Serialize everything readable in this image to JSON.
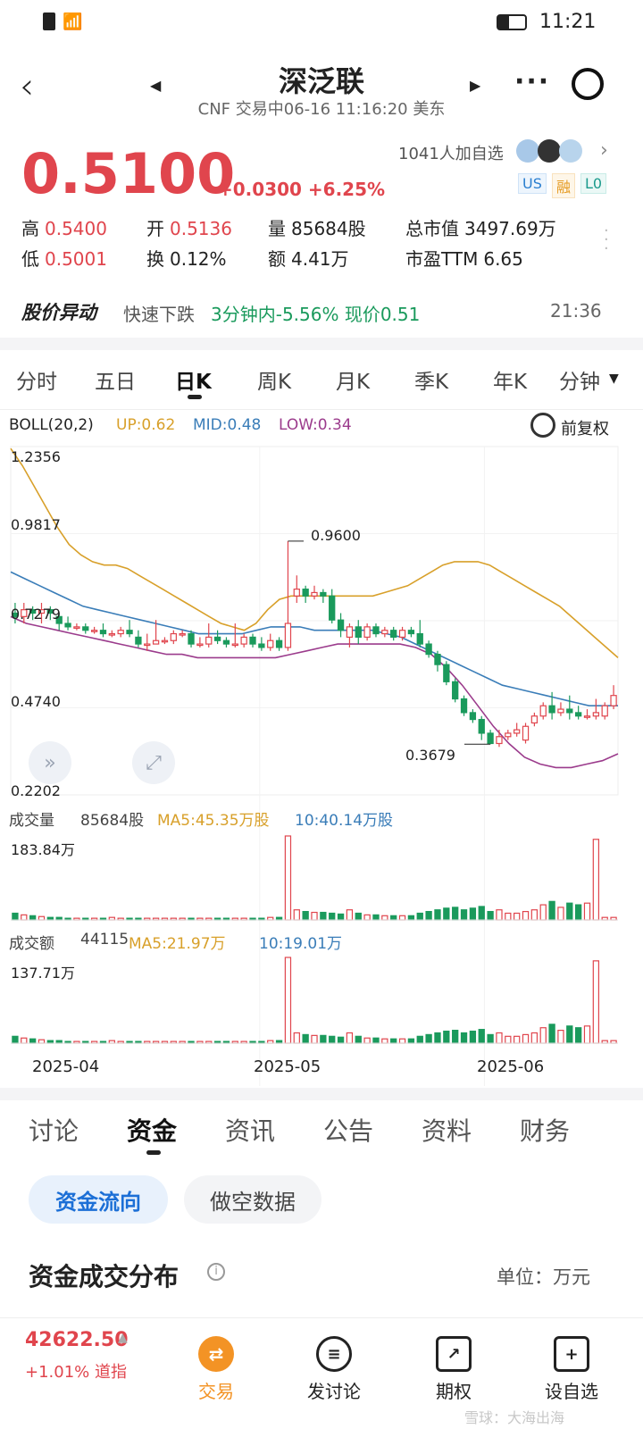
{
  "status": {
    "time": "11:21"
  },
  "header": {
    "title": "深泛联",
    "subtitle": "CNF 交易中06-16 11:16:20 美东"
  },
  "quote": {
    "price": "0.5100",
    "change": "+0.0300 +6.25%",
    "watchers": "1041人加自选",
    "badges": [
      "US",
      "融",
      "L0"
    ],
    "stats": [
      {
        "label": "高",
        "value": "0.5400",
        "color": "red"
      },
      {
        "label": "开",
        "value": "0.5136",
        "color": "red"
      },
      {
        "label": "量",
        "value": "85684股",
        "color": "plain"
      },
      {
        "label": "总市值",
        "value": "3497.69万",
        "color": "plain"
      },
      {
        "label": "低",
        "value": "0.5001",
        "color": "red"
      },
      {
        "label": "换",
        "value": "0.12%",
        "color": "plain"
      },
      {
        "label": "额",
        "value": "4.41万",
        "color": "plain"
      },
      {
        "label": "市盈TTM",
        "value": "6.65",
        "color": "plain"
      }
    ]
  },
  "alert": {
    "label": "股价异动",
    "type": "快速下跌",
    "detail": "3分钟内-5.56% 现价0.51",
    "time": "21:36"
  },
  "period_tabs": [
    "分时",
    "五日",
    "日K",
    "周K",
    "月K",
    "季K",
    "年K",
    "分钟"
  ],
  "active_period": "日K",
  "boll": {
    "name": "BOLL(20,2)",
    "up": "UP:0.62",
    "mid": "MID:0.48",
    "low": "LOW:0.34",
    "adjust": "前复权"
  },
  "price_axis": [
    "1.2356",
    "0.9817",
    "0.7279",
    "0.4740",
    "0.2202"
  ],
  "annotations": {
    "high": "0.9600",
    "low": "0.3679"
  },
  "volume": {
    "label": "成交量",
    "value": "85684股",
    "ma5": "MA5:45.35万股",
    "ma10": "10:40.14万股",
    "max": "183.84万"
  },
  "amount": {
    "label": "成交额",
    "value": "44115",
    "ma5": "MA5:21.97万",
    "ma10": "10:19.01万",
    "max": "137.71万"
  },
  "x_dates": [
    "2025-04",
    "2025-05",
    "2025-06"
  ],
  "chart_data": {
    "type": "candlestick",
    "price_range": [
      0.2202,
      1.2356
    ],
    "candles": [
      {
        "o": 0.75,
        "c": 0.74,
        "h": 0.78,
        "l": 0.72,
        "v": 8
      },
      {
        "o": 0.74,
        "c": 0.76,
        "h": 0.78,
        "l": 0.72,
        "v": 6
      },
      {
        "o": 0.76,
        "c": 0.75,
        "h": 0.77,
        "l": 0.73,
        "v": 5
      },
      {
        "o": 0.75,
        "c": 0.76,
        "h": 0.78,
        "l": 0.72,
        "v": 4
      },
      {
        "o": 0.76,
        "c": 0.75,
        "h": 0.77,
        "l": 0.73,
        "v": 3
      },
      {
        "o": 0.74,
        "c": 0.72,
        "h": 0.75,
        "l": 0.7,
        "v": 3
      },
      {
        "o": 0.72,
        "c": 0.71,
        "h": 0.74,
        "l": 0.7,
        "v": 2
      },
      {
        "o": 0.71,
        "c": 0.71,
        "h": 0.72,
        "l": 0.7,
        "v": 2
      },
      {
        "o": 0.71,
        "c": 0.7,
        "h": 0.72,
        "l": 0.69,
        "v": 2
      },
      {
        "o": 0.7,
        "c": 0.7,
        "h": 0.71,
        "l": 0.69,
        "v": 2
      },
      {
        "o": 0.7,
        "c": 0.69,
        "h": 0.72,
        "l": 0.68,
        "v": 2
      },
      {
        "o": 0.69,
        "c": 0.69,
        "h": 0.7,
        "l": 0.68,
        "v": 3
      },
      {
        "o": 0.69,
        "c": 0.7,
        "h": 0.71,
        "l": 0.68,
        "v": 2
      },
      {
        "o": 0.7,
        "c": 0.69,
        "h": 0.73,
        "l": 0.68,
        "v": 2
      },
      {
        "o": 0.68,
        "c": 0.66,
        "h": 0.7,
        "l": 0.65,
        "v": 2
      },
      {
        "o": 0.66,
        "c": 0.66,
        "h": 0.69,
        "l": 0.64,
        "v": 2
      },
      {
        "o": 0.66,
        "c": 0.67,
        "h": 0.73,
        "l": 0.66,
        "v": 2
      },
      {
        "o": 0.67,
        "c": 0.67,
        "h": 0.68,
        "l": 0.66,
        "v": 2
      },
      {
        "o": 0.67,
        "c": 0.69,
        "h": 0.7,
        "l": 0.66,
        "v": 2
      },
      {
        "o": 0.69,
        "c": 0.69,
        "h": 0.7,
        "l": 0.68,
        "v": 2
      },
      {
        "o": 0.69,
        "c": 0.66,
        "h": 0.7,
        "l": 0.65,
        "v": 2
      },
      {
        "o": 0.66,
        "c": 0.66,
        "h": 0.68,
        "l": 0.65,
        "v": 2
      },
      {
        "o": 0.66,
        "c": 0.68,
        "h": 0.72,
        "l": 0.65,
        "v": 2
      },
      {
        "o": 0.68,
        "c": 0.67,
        "h": 0.7,
        "l": 0.66,
        "v": 2
      },
      {
        "o": 0.67,
        "c": 0.66,
        "h": 0.68,
        "l": 0.65,
        "v": 2
      },
      {
        "o": 0.66,
        "c": 0.66,
        "h": 0.72,
        "l": 0.65,
        "v": 2
      },
      {
        "o": 0.66,
        "c": 0.68,
        "h": 0.69,
        "l": 0.65,
        "v": 2
      },
      {
        "o": 0.68,
        "c": 0.66,
        "h": 0.69,
        "l": 0.65,
        "v": 2
      },
      {
        "o": 0.66,
        "c": 0.65,
        "h": 0.68,
        "l": 0.64,
        "v": 2
      },
      {
        "o": 0.65,
        "c": 0.67,
        "h": 0.69,
        "l": 0.64,
        "v": 3
      },
      {
        "o": 0.67,
        "c": 0.65,
        "h": 0.68,
        "l": 0.64,
        "v": 3
      },
      {
        "o": 0.65,
        "c": 0.72,
        "h": 0.96,
        "l": 0.64,
        "v": 100
      },
      {
        "o": 0.8,
        "c": 0.82,
        "h": 0.86,
        "l": 0.78,
        "v": 12
      },
      {
        "o": 0.82,
        "c": 0.8,
        "h": 0.83,
        "l": 0.78,
        "v": 10
      },
      {
        "o": 0.8,
        "c": 0.81,
        "h": 0.83,
        "l": 0.79,
        "v": 9
      },
      {
        "o": 0.81,
        "c": 0.8,
        "h": 0.82,
        "l": 0.78,
        "v": 9
      },
      {
        "o": 0.8,
        "c": 0.73,
        "h": 0.82,
        "l": 0.72,
        "v": 8
      },
      {
        "o": 0.73,
        "c": 0.7,
        "h": 0.75,
        "l": 0.68,
        "v": 7
      },
      {
        "o": 0.68,
        "c": 0.71,
        "h": 0.72,
        "l": 0.65,
        "v": 12
      },
      {
        "o": 0.71,
        "c": 0.68,
        "h": 0.73,
        "l": 0.66,
        "v": 8
      },
      {
        "o": 0.68,
        "c": 0.71,
        "h": 0.72,
        "l": 0.67,
        "v": 6
      },
      {
        "o": 0.71,
        "c": 0.69,
        "h": 0.72,
        "l": 0.68,
        "v": 6
      },
      {
        "o": 0.69,
        "c": 0.7,
        "h": 0.71,
        "l": 0.68,
        "v": 5
      },
      {
        "o": 0.7,
        "c": 0.68,
        "h": 0.71,
        "l": 0.67,
        "v": 5
      },
      {
        "o": 0.68,
        "c": 0.7,
        "h": 0.71,
        "l": 0.67,
        "v": 5
      },
      {
        "o": 0.7,
        "c": 0.69,
        "h": 0.71,
        "l": 0.68,
        "v": 5
      },
      {
        "o": 0.69,
        "c": 0.66,
        "h": 0.73,
        "l": 0.65,
        "v": 8
      },
      {
        "o": 0.66,
        "c": 0.63,
        "h": 0.67,
        "l": 0.62,
        "v": 10
      },
      {
        "o": 0.63,
        "c": 0.6,
        "h": 0.64,
        "l": 0.58,
        "v": 12
      },
      {
        "o": 0.6,
        "c": 0.55,
        "h": 0.61,
        "l": 0.54,
        "v": 14
      },
      {
        "o": 0.55,
        "c": 0.5,
        "h": 0.56,
        "l": 0.49,
        "v": 15
      },
      {
        "o": 0.5,
        "c": 0.46,
        "h": 0.51,
        "l": 0.45,
        "v": 12
      },
      {
        "o": 0.46,
        "c": 0.44,
        "h": 0.47,
        "l": 0.43,
        "v": 14
      },
      {
        "o": 0.44,
        "c": 0.4,
        "h": 0.45,
        "l": 0.38,
        "v": 16
      },
      {
        "o": 0.4,
        "c": 0.37,
        "h": 0.41,
        "l": 0.3679,
        "v": 10
      },
      {
        "o": 0.37,
        "c": 0.39,
        "h": 0.41,
        "l": 0.36,
        "v": 12
      },
      {
        "o": 0.39,
        "c": 0.4,
        "h": 0.41,
        "l": 0.38,
        "v": 8
      },
      {
        "o": 0.4,
        "c": 0.41,
        "h": 0.43,
        "l": 0.39,
        "v": 8
      },
      {
        "o": 0.38,
        "c": 0.42,
        "h": 0.43,
        "l": 0.37,
        "v": 10
      },
      {
        "o": 0.43,
        "c": 0.45,
        "h": 0.46,
        "l": 0.42,
        "v": 12
      },
      {
        "o": 0.45,
        "c": 0.48,
        "h": 0.49,
        "l": 0.44,
        "v": 18
      },
      {
        "o": 0.48,
        "c": 0.46,
        "h": 0.52,
        "l": 0.44,
        "v": 22
      },
      {
        "o": 0.46,
        "c": 0.47,
        "h": 0.49,
        "l": 0.45,
        "v": 15
      },
      {
        "o": 0.47,
        "c": 0.46,
        "h": 0.51,
        "l": 0.44,
        "v": 20
      },
      {
        "o": 0.46,
        "c": 0.45,
        "h": 0.48,
        "l": 0.44,
        "v": 18
      },
      {
        "o": 0.45,
        "c": 0.45,
        "h": 0.47,
        "l": 0.44,
        "v": 20
      },
      {
        "o": 0.45,
        "c": 0.46,
        "h": 0.5,
        "l": 0.44,
        "v": 96
      },
      {
        "o": 0.45,
        "c": 0.48,
        "h": 0.49,
        "l": 0.44,
        "v": 3
      },
      {
        "o": 0.48,
        "c": 0.51,
        "h": 0.54,
        "l": 0.47,
        "v": 3
      }
    ],
    "boll_up": [
      1.23,
      1.18,
      1.12,
      1.06,
      1.0,
      0.95,
      0.92,
      0.9,
      0.89,
      0.89,
      0.88,
      0.86,
      0.84,
      0.82,
      0.8,
      0.78,
      0.76,
      0.74,
      0.72,
      0.71,
      0.7,
      0.72,
      0.76,
      0.79,
      0.8,
      0.8,
      0.8,
      0.8,
      0.8,
      0.8,
      0.8,
      0.8,
      0.81,
      0.82,
      0.83,
      0.85,
      0.87,
      0.89,
      0.9,
      0.9,
      0.9,
      0.89,
      0.87,
      0.85,
      0.83,
      0.81,
      0.79,
      0.77,
      0.74,
      0.71,
      0.68,
      0.65,
      0.62
    ],
    "boll_mid": [
      0.87,
      0.85,
      0.83,
      0.81,
      0.79,
      0.77,
      0.76,
      0.75,
      0.74,
      0.73,
      0.72,
      0.71,
      0.7,
      0.69,
      0.69,
      0.69,
      0.69,
      0.7,
      0.71,
      0.71,
      0.71,
      0.7,
      0.7,
      0.7,
      0.7,
      0.7,
      0.69,
      0.68,
      0.66,
      0.64,
      0.62,
      0.6,
      0.58,
      0.56,
      0.54,
      0.53,
      0.52,
      0.51,
      0.5,
      0.49,
      0.48,
      0.48,
      0.48
    ],
    "boll_low": [
      0.74,
      0.72,
      0.71,
      0.7,
      0.69,
      0.68,
      0.67,
      0.66,
      0.65,
      0.64,
      0.63,
      0.63,
      0.62,
      0.62,
      0.62,
      0.62,
      0.62,
      0.62,
      0.63,
      0.64,
      0.65,
      0.66,
      0.66,
      0.66,
      0.66,
      0.66,
      0.65,
      0.63,
      0.59,
      0.54,
      0.48,
      0.42,
      0.37,
      0.33,
      0.31,
      0.3,
      0.3,
      0.31,
      0.32,
      0.34
    ]
  },
  "info_tabs": [
    "讨论",
    "资金",
    "资讯",
    "公告",
    "资料",
    "财务"
  ],
  "active_info_tab": "资金",
  "sub_tabs": [
    "资金流向",
    "做空数据"
  ],
  "section": {
    "title": "资金成交分布",
    "unit": "单位：万元"
  },
  "footer": {
    "index_value": "42622.50",
    "index_change": "+1.01% 道指",
    "nav": [
      "交易",
      "发讨论",
      "期权",
      "设自选"
    ],
    "watermark": "雪球：大海出海"
  }
}
